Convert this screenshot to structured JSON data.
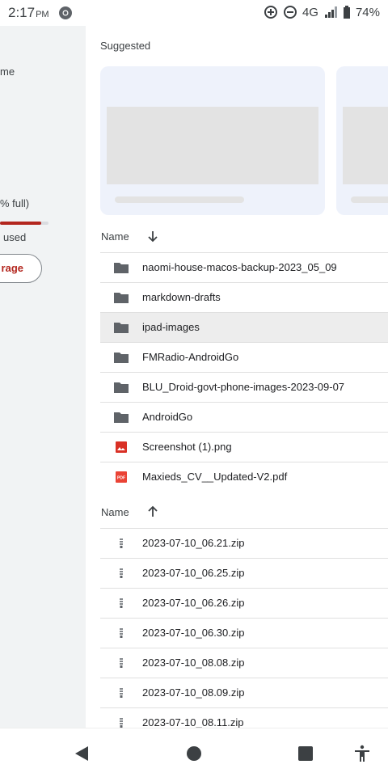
{
  "status": {
    "time": "2:17",
    "ampm": "PM",
    "network": "4G",
    "battery": "74%"
  },
  "drawer": {
    "shared_label": "me",
    "quota_text": "% full)",
    "used_text": "used",
    "storage_button": "rage",
    "quota_fraction": 0.85
  },
  "suggested": {
    "title": "Suggested"
  },
  "folders_section": {
    "sort_label": "Name",
    "sort_direction": "descending",
    "items": [
      {
        "name": "naomi-house-macos-backup-2023_05_09",
        "type": "folder"
      },
      {
        "name": "markdown-drafts",
        "type": "folder"
      },
      {
        "name": "ipad-images",
        "type": "folder",
        "selected": true
      },
      {
        "name": "FMRadio-AndroidGo",
        "type": "folder"
      },
      {
        "name": "BLU_Droid-govt-phone-images-2023-09-07",
        "type": "folder"
      },
      {
        "name": "AndroidGo",
        "type": "folder"
      },
      {
        "name": "Screenshot (1).png",
        "type": "image"
      },
      {
        "name": "Maxieds_CV__Updated-V2.pdf",
        "type": "pdf"
      }
    ]
  },
  "files_section": {
    "sort_label": "Name",
    "sort_direction": "ascending",
    "items": [
      {
        "name": "2023-07-10_06.21.zip",
        "type": "zip"
      },
      {
        "name": "2023-07-10_06.25.zip",
        "type": "zip"
      },
      {
        "name": "2023-07-10_06.26.zip",
        "type": "zip"
      },
      {
        "name": "2023-07-10_06.30.zip",
        "type": "zip"
      },
      {
        "name": "2023-07-10_08.08.zip",
        "type": "zip"
      },
      {
        "name": "2023-07-10_08.09.zip",
        "type": "zip"
      },
      {
        "name": "2023-07-10_08.11.zip",
        "type": "zip"
      }
    ]
  },
  "icons": {
    "folder": "folder-icon",
    "image": "image-file-icon",
    "pdf": "pdf-file-icon",
    "zip": "zip-file-icon"
  },
  "colors": {
    "accent_red": "#b3261e",
    "folder_gray": "#5f6368",
    "image_red": "#d93025",
    "pdf_red": "#ea4335"
  }
}
